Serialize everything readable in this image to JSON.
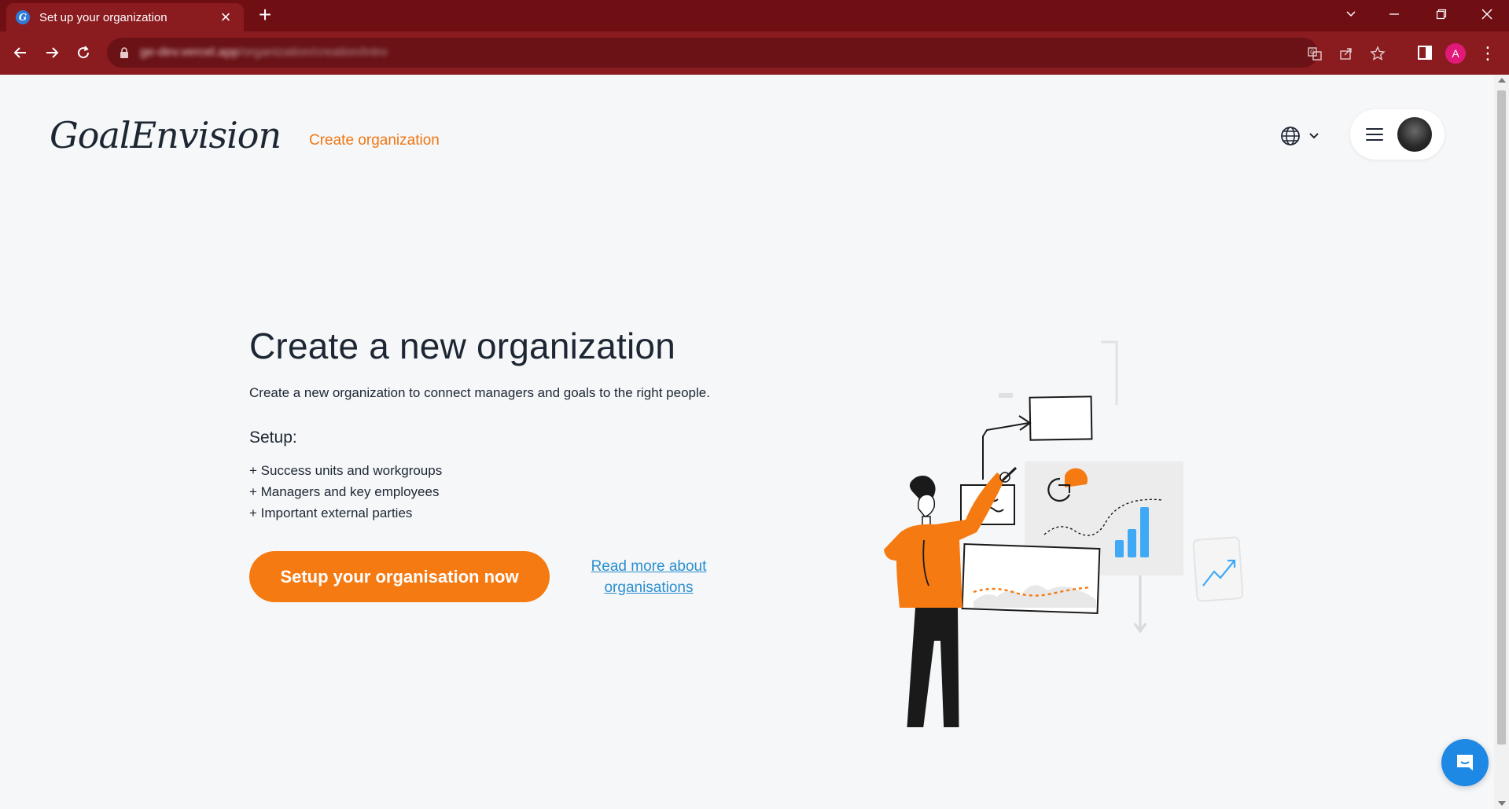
{
  "browser": {
    "tab_title": "Set up your organization",
    "favicon_letter": "G",
    "url_host": "ge-dev.vercel.app",
    "url_path": "/organization/creation/intro",
    "profile_initial": "A"
  },
  "header": {
    "logo_text": "GoalEnvision",
    "nav_create": "Create organization"
  },
  "main": {
    "title": "Create a new organization",
    "description": "Create a new organization to connect managers and goals to the right people.",
    "setup_title": "Setup:",
    "setup_items": [
      "+ Success units and workgroups",
      "+ Managers and key employees",
      "+ Important external parties"
    ],
    "cta_label": "Setup your organisation now",
    "read_more_label": "Read more about organisations"
  },
  "colors": {
    "accent_orange": "#f57a12",
    "link_blue": "#2a8fd0",
    "chrome_red": "#8a1b1f",
    "chat_blue": "#1e88e5"
  }
}
